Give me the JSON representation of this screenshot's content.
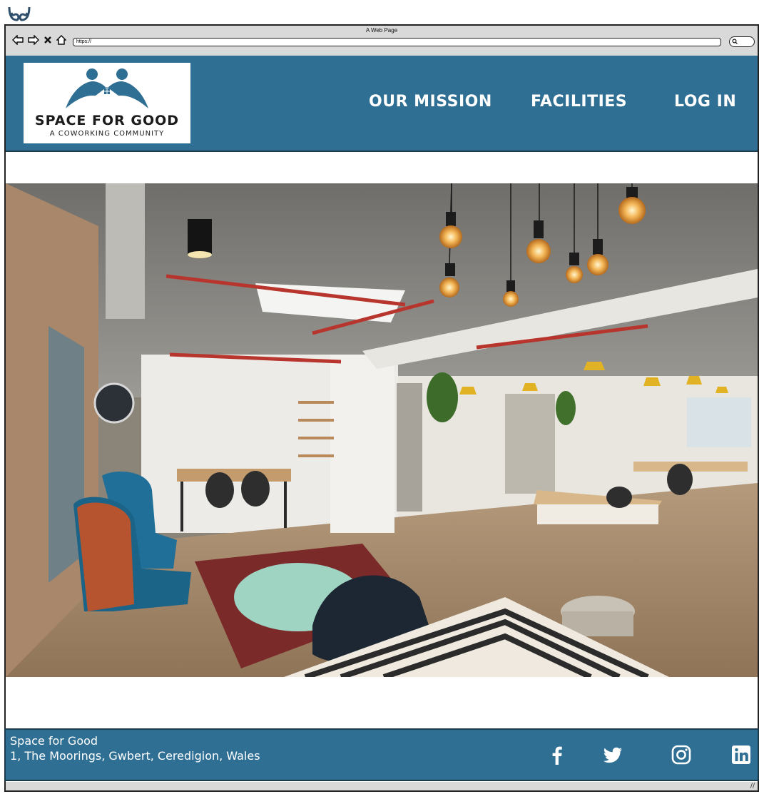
{
  "browser": {
    "window_title": "A Web Page",
    "url": "https://"
  },
  "header": {
    "logo_name": "SPACE FOR GOOD",
    "logo_tagline": "A COWORKING COMMUNITY",
    "nav": [
      {
        "label": "OUR MISSION"
      },
      {
        "label": "FACILITIES"
      },
      {
        "label": "LOG IN"
      }
    ]
  },
  "footer": {
    "name": "Space for Good",
    "address": "1, The Moorings, Gwbert, Ceredigion, Wales",
    "social": [
      "facebook-icon",
      "twitter-icon",
      "instagram-icon",
      "linkedin-icon"
    ]
  },
  "colors": {
    "brand": "#2f6f93",
    "header_text": "#ffffff"
  }
}
